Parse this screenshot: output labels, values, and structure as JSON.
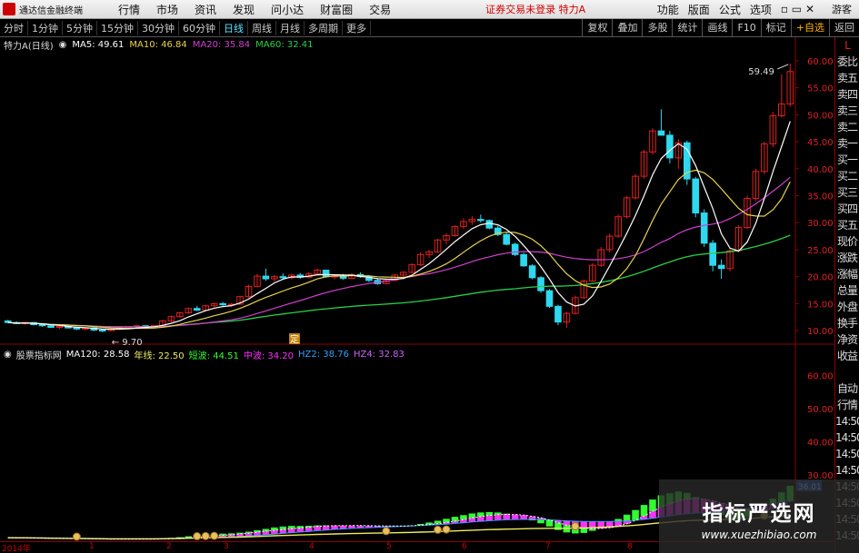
{
  "app": {
    "title": "通达信金融终端",
    "alert": "证券交易未登录",
    "security": "特力A",
    "guest": "游客"
  },
  "menu": [
    "行情",
    "市场",
    "资讯",
    "发现",
    "问小达",
    "财富圈",
    "交易"
  ],
  "menu_right": [
    "功能",
    "版面",
    "公式",
    "选项"
  ],
  "periods": [
    "分时",
    "1分钟",
    "5分钟",
    "15分钟",
    "30分钟",
    "60分钟",
    "日线",
    "周线",
    "月线",
    "多周期",
    "更多"
  ],
  "active_period": "日线",
  "toolbar_right": [
    "复权",
    "叠加",
    "多股",
    "统计",
    "画线",
    "F10",
    "标记",
    "+自选",
    "返回"
  ],
  "main_legend": {
    "stock": "特力A(日线)",
    "ma5": "MA5: 49.61",
    "ma10": "MA10: 46.84",
    "ma20": "MA20: 35.84",
    "ma60": "MA60: 32.41"
  },
  "ind_legend": {
    "name": "股票指标网",
    "ma120": "MA120: 28.58",
    "nianxian": "年线: 22.50",
    "duanbo": "短波: 44.51",
    "zhongbo": "中波: 34.20",
    "hz2": "HZ2: 38.76",
    "hz4": "HZ4: 32.83"
  },
  "colors": {
    "up": "#e0201c",
    "down": "#2ed8ee",
    "ma5": "#ffffff",
    "ma10": "#e8d24a",
    "ma20": "#d040d0",
    "ma60": "#28d048",
    "nianxian": "#f0ec60",
    "duanbo": "#30ff30",
    "zhongbo": "#ff30ff",
    "hz2": "#30a0ff",
    "hz4": "#d060ff",
    "frame": "#8b0000"
  },
  "price_axis": [
    "60.00",
    "55.00",
    "50.00",
    "45.00",
    "40.00",
    "35.00",
    "30.00",
    "25.00",
    "20.00",
    "15.00",
    "10.00"
  ],
  "ind_axis": [
    "60.00",
    "50.00",
    "40.00",
    "30.00"
  ],
  "annotations": {
    "high": "59.49",
    "low": "9.70",
    "marker": "定",
    "ind_value": "36.01"
  },
  "time_labels": [
    "2014年",
    "1",
    "2",
    "3",
    "4",
    "5",
    "6",
    "7",
    "8"
  ],
  "sidebar": [
    "L",
    "委比",
    "卖五",
    "卖四",
    "卖三",
    "卖二",
    "卖一",
    "买一",
    "买二",
    "买三",
    "买四",
    "买五",
    "现价",
    "涨跌",
    "涨幅",
    "总量",
    "外盘",
    "换手",
    "净资",
    "收益",
    "",
    "自动",
    "行情",
    "14:50",
    "14:50",
    "14:50",
    "14:50",
    "14:50",
    "14:50",
    "14:50",
    "14:50"
  ],
  "top_right_tag": "L R",
  "watermark": {
    "line1": "指标严选网",
    "line2": "www.xuezhibiao.com"
  },
  "chart_data": {
    "type": "candlestick",
    "title": "特力A(日线)",
    "ylim": [
      8,
      62
    ],
    "ohlc": [
      [
        11.8,
        12,
        11.4,
        11.5
      ],
      [
        11.5,
        11.7,
        11.2,
        11.3
      ],
      [
        11.3,
        11.6,
        11.1,
        11.5
      ],
      [
        11.5,
        11.6,
        11,
        11.1
      ],
      [
        11.1,
        11.3,
        10.7,
        10.9
      ],
      [
        10.9,
        11.1,
        10.5,
        10.6
      ],
      [
        10.6,
        10.9,
        10.3,
        10.8
      ],
      [
        10.8,
        11,
        10.4,
        10.5
      ],
      [
        10.5,
        10.7,
        10.1,
        10.3
      ],
      [
        10.3,
        10.6,
        10,
        10.5
      ],
      [
        10.5,
        10.6,
        9.9,
        10.1
      ],
      [
        10.1,
        10.3,
        9.7,
        10
      ],
      [
        10,
        10.4,
        9.9,
        10.3
      ],
      [
        10.3,
        10.6,
        10.1,
        10.5
      ],
      [
        10.5,
        10.8,
        10.3,
        10.7
      ],
      [
        10.7,
        11,
        10.5,
        10.9
      ],
      [
        10.9,
        11,
        10.5,
        10.6
      ],
      [
        10.6,
        11,
        10.5,
        10.9
      ],
      [
        10.9,
        12,
        10.8,
        11.8
      ],
      [
        11.8,
        12.8,
        11.6,
        12.6
      ],
      [
        12.6,
        13.5,
        12.4,
        13.3
      ],
      [
        13.3,
        14.3,
        13.1,
        14.1
      ],
      [
        14.1,
        14.6,
        13.6,
        13.8
      ],
      [
        13.8,
        14.8,
        13.7,
        14.6
      ],
      [
        14.6,
        15.2,
        14.3,
        15
      ],
      [
        15,
        15.3,
        14.6,
        14.8
      ],
      [
        14.8,
        15.1,
        14.4,
        14.9
      ],
      [
        14.9,
        16.5,
        14.8,
        16.3
      ],
      [
        16.3,
        18.5,
        16.1,
        18.2
      ],
      [
        18.2,
        20.5,
        18,
        20.1
      ],
      [
        20.1,
        21.5,
        19.2,
        19.6
      ],
      [
        19.6,
        20.3,
        19,
        20
      ],
      [
        20,
        20.6,
        19.4,
        19.8
      ],
      [
        19.8,
        20.5,
        19.5,
        20.3
      ],
      [
        20.3,
        20.7,
        19.6,
        19.9
      ],
      [
        19.9,
        20.8,
        19.7,
        20.5
      ],
      [
        20.5,
        21.5,
        20.3,
        21.2
      ],
      [
        21.2,
        21.3,
        19.8,
        20
      ],
      [
        20,
        20.4,
        19.5,
        20.1
      ],
      [
        20.1,
        20.5,
        19.4,
        19.7
      ],
      [
        19.7,
        20.6,
        19.6,
        20.4
      ],
      [
        20.4,
        20.8,
        19.8,
        20
      ],
      [
        20,
        20.3,
        19,
        19.3
      ],
      [
        19.3,
        19.6,
        18.5,
        18.7
      ],
      [
        18.7,
        19.5,
        18.6,
        19.3
      ],
      [
        19.3,
        20.5,
        19.2,
        20.3
      ],
      [
        20.3,
        21,
        20,
        20.8
      ],
      [
        20.8,
        22.5,
        20.6,
        22.2
      ],
      [
        22.2,
        24.5,
        22,
        24.1
      ],
      [
        24.1,
        25,
        23.5,
        24.6
      ],
      [
        24.6,
        27,
        24.4,
        26.8
      ],
      [
        26.8,
        28,
        26,
        27.6
      ],
      [
        27.6,
        29.5,
        27.4,
        29.3
      ],
      [
        29.3,
        30.8,
        28.8,
        30.2
      ],
      [
        30.2,
        31.2,
        29.6,
        30.6
      ],
      [
        30.6,
        31.5,
        30,
        30.4
      ],
      [
        30.4,
        30.6,
        28.8,
        29
      ],
      [
        29,
        29.4,
        27.5,
        27.8
      ],
      [
        27.8,
        28.1,
        25.8,
        26
      ],
      [
        26,
        26.3,
        23.8,
        24.1
      ],
      [
        24.1,
        24.4,
        21.8,
        22
      ],
      [
        22,
        22.3,
        19.5,
        19.8
      ],
      [
        19.8,
        20.1,
        17,
        17.4
      ],
      [
        17.4,
        17.7,
        14.2,
        14.5
      ],
      [
        14.5,
        14.8,
        11,
        11.6
      ],
      [
        11.6,
        13.5,
        10.5,
        13.2
      ],
      [
        13.2,
        16.5,
        13,
        16.1
      ],
      [
        16.1,
        19.5,
        15.9,
        19.2
      ],
      [
        19.2,
        22.5,
        19,
        22.1
      ],
      [
        22.1,
        25.5,
        21.8,
        25
      ],
      [
        25,
        28,
        24.5,
        27.5
      ],
      [
        27.5,
        31.5,
        27.2,
        31.1
      ],
      [
        31.1,
        35,
        30.8,
        34.6
      ],
      [
        34.6,
        39,
        34.3,
        38.6
      ],
      [
        38.6,
        43.5,
        38.2,
        43.1
      ],
      [
        43.1,
        47.5,
        42.6,
        47
      ],
      [
        47,
        51,
        46.5,
        46.2
      ],
      [
        46.2,
        47,
        41,
        42
      ],
      [
        42,
        45.5,
        40,
        44.8
      ],
      [
        44.8,
        45.2,
        37,
        38.1
      ],
      [
        38.1,
        38.5,
        31,
        31.8
      ],
      [
        31.8,
        32.5,
        25.5,
        26.2
      ],
      [
        26.2,
        26.8,
        21,
        22.1
      ],
      [
        22.1,
        23.2,
        19.6,
        21.5
      ],
      [
        21.5,
        25.2,
        21,
        24.8
      ],
      [
        24.8,
        29.5,
        24.5,
        29.1
      ],
      [
        29.1,
        35,
        28.8,
        34.5
      ],
      [
        34.5,
        40,
        34,
        39.5
      ],
      [
        39.5,
        45,
        39,
        44.6
      ],
      [
        44.6,
        50.5,
        44,
        49.8
      ],
      [
        49.8,
        57.5,
        49.5,
        52
      ],
      [
        52,
        59.49,
        51.5,
        58
      ]
    ]
  }
}
